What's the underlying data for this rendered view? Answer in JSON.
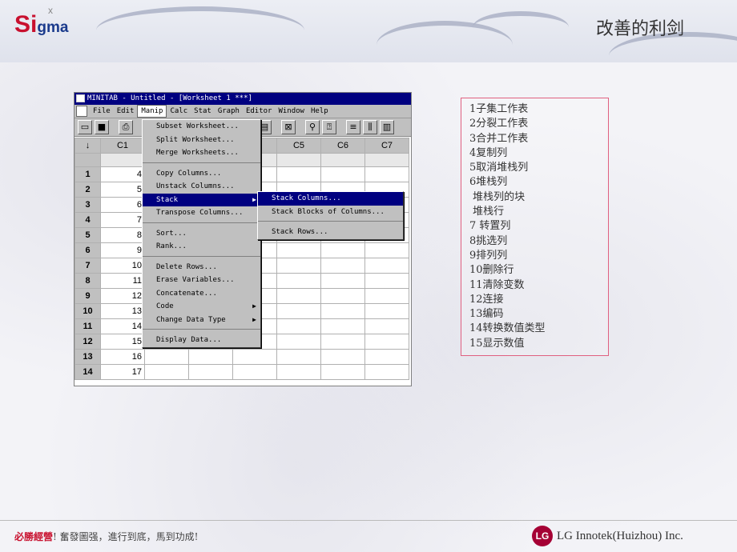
{
  "header": {
    "logo_main": "Si",
    "logo_sub": "gma",
    "logo_super": "x",
    "slide_title": "改善的利剑"
  },
  "minitab": {
    "title": "MINITAB - Untitled - [Worksheet 1 ***]",
    "menus": [
      "File",
      "Edit",
      "Manip",
      "Calc",
      "Stat",
      "Graph",
      "Editor",
      "Window",
      "Help"
    ],
    "active_menu": "Manip",
    "column_headers": [
      "C1",
      "",
      "",
      "",
      "C5",
      "C6",
      "C7"
    ],
    "row_labels": [
      "1",
      "2",
      "3",
      "4",
      "5",
      "6",
      "7",
      "8",
      "9",
      "10",
      "11",
      "12",
      "13",
      "14"
    ],
    "c1_values": [
      "4",
      "5",
      "6",
      "7",
      "8",
      "9",
      "10",
      "11",
      "12",
      "13",
      "14",
      "15",
      "16",
      "17"
    ],
    "manip_menu": [
      {
        "label": "Subset Worksheet...",
        "submenu": false
      },
      {
        "label": "Split Worksheet...",
        "submenu": false
      },
      {
        "label": "Merge Worksheets...",
        "submenu": false
      },
      {
        "sep": true
      },
      {
        "label": "Copy Columns...",
        "submenu": false
      },
      {
        "label": "Unstack Columns...",
        "submenu": false
      },
      {
        "label": "Stack",
        "submenu": true,
        "selected": true
      },
      {
        "label": "Transpose Columns...",
        "submenu": false
      },
      {
        "sep": true
      },
      {
        "label": "Sort...",
        "submenu": false
      },
      {
        "label": "Rank...",
        "submenu": false
      },
      {
        "sep": true
      },
      {
        "label": "Delete Rows...",
        "submenu": false
      },
      {
        "label": "Erase Variables...",
        "submenu": false
      },
      {
        "label": "Concatenate...",
        "submenu": false
      },
      {
        "label": "Code",
        "submenu": true
      },
      {
        "label": "Change Data Type",
        "submenu": true
      },
      {
        "sep": true
      },
      {
        "label": "Display Data...",
        "submenu": false
      }
    ],
    "stack_submenu": [
      {
        "label": "Stack Columns...",
        "selected": true
      },
      {
        "label": "Stack Blocks of Columns..."
      },
      {
        "sep": true
      },
      {
        "label": "Stack Rows..."
      }
    ]
  },
  "notes": [
    "1子集工作表",
    "2分裂工作表",
    "3合并工作表",
    "4复制列",
    "5取消堆栈列",
    "6堆栈列",
    " 堆栈列的块",
    " 堆栈行",
    "7 转置列",
    "8挑选列",
    "9排列列",
    "10删除行",
    "11清除变数",
    "12连接",
    "13编码",
    "14转换数值类型",
    "15显示数值"
  ],
  "footer": {
    "motto_em": "必勝經營",
    "motto_rest": "! 奮發圖强，進行到底，馬到功成!",
    "company": "LG Innotek(Huizhou) Inc.",
    "company_logo": "LG"
  }
}
